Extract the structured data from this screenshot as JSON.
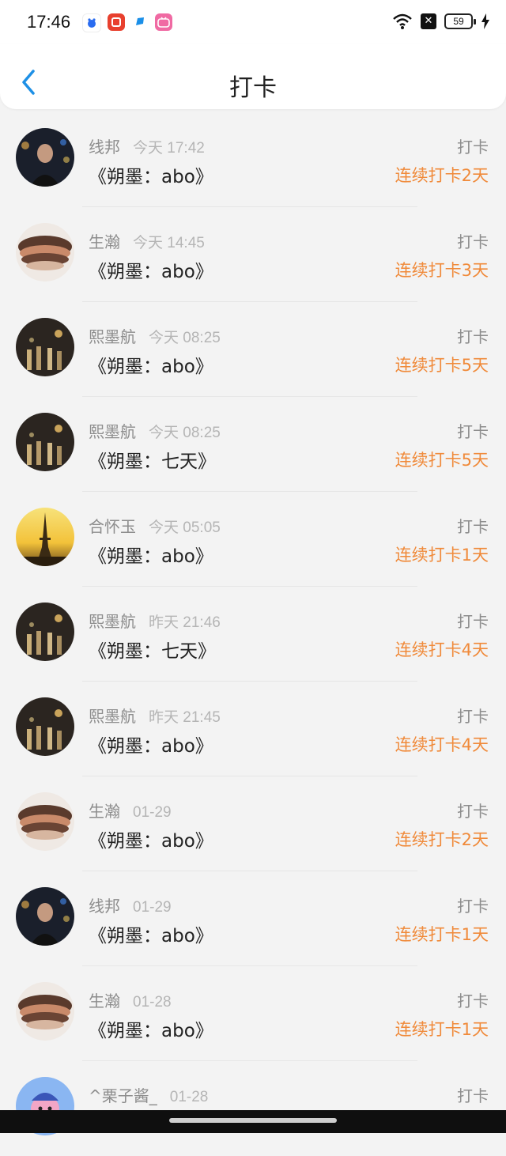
{
  "status_bar": {
    "time": "17:46",
    "battery": "59"
  },
  "header": {
    "title": "打卡",
    "back_icon": "chevron-left-icon"
  },
  "colors": {
    "accent_blue": "#1e90e6",
    "streak_orange": "#f08a3a"
  },
  "checkins": [
    {
      "name": "线邦",
      "time": "今天 17:42",
      "book": "《朔墨：abo》",
      "label": "打卡",
      "streak": "连续打卡2天"
    },
    {
      "name": "生瀚",
      "time": "今天 14:45",
      "book": "《朔墨：abo》",
      "label": "打卡",
      "streak": "连续打卡3天"
    },
    {
      "name": "熙墨航",
      "time": "今天 08:25",
      "book": "《朔墨：abo》",
      "label": "打卡",
      "streak": "连续打卡5天"
    },
    {
      "name": "熙墨航",
      "time": "今天 08:25",
      "book": "《朔墨：七天》",
      "label": "打卡",
      "streak": "连续打卡5天"
    },
    {
      "name": "合怀玉",
      "time": "今天 05:05",
      "book": "《朔墨：abo》",
      "label": "打卡",
      "streak": "连续打卡1天"
    },
    {
      "name": "熙墨航",
      "time": "昨天 21:46",
      "book": "《朔墨：七天》",
      "label": "打卡",
      "streak": "连续打卡4天"
    },
    {
      "name": "熙墨航",
      "time": "昨天 21:45",
      "book": "《朔墨：abo》",
      "label": "打卡",
      "streak": "连续打卡4天"
    },
    {
      "name": "生瀚",
      "time": "01-29",
      "book": "《朔墨：abo》",
      "label": "打卡",
      "streak": "连续打卡2天"
    },
    {
      "name": "线邦",
      "time": "01-29",
      "book": "《朔墨：abo》",
      "label": "打卡",
      "streak": "连续打卡1天"
    },
    {
      "name": "生瀚",
      "time": "01-28",
      "book": "《朔墨：abo》",
      "label": "打卡",
      "streak": "连续打卡1天"
    },
    {
      "name": "^栗子酱_",
      "time": "01-28",
      "book": "",
      "label": "打卡",
      "streak": ""
    }
  ]
}
